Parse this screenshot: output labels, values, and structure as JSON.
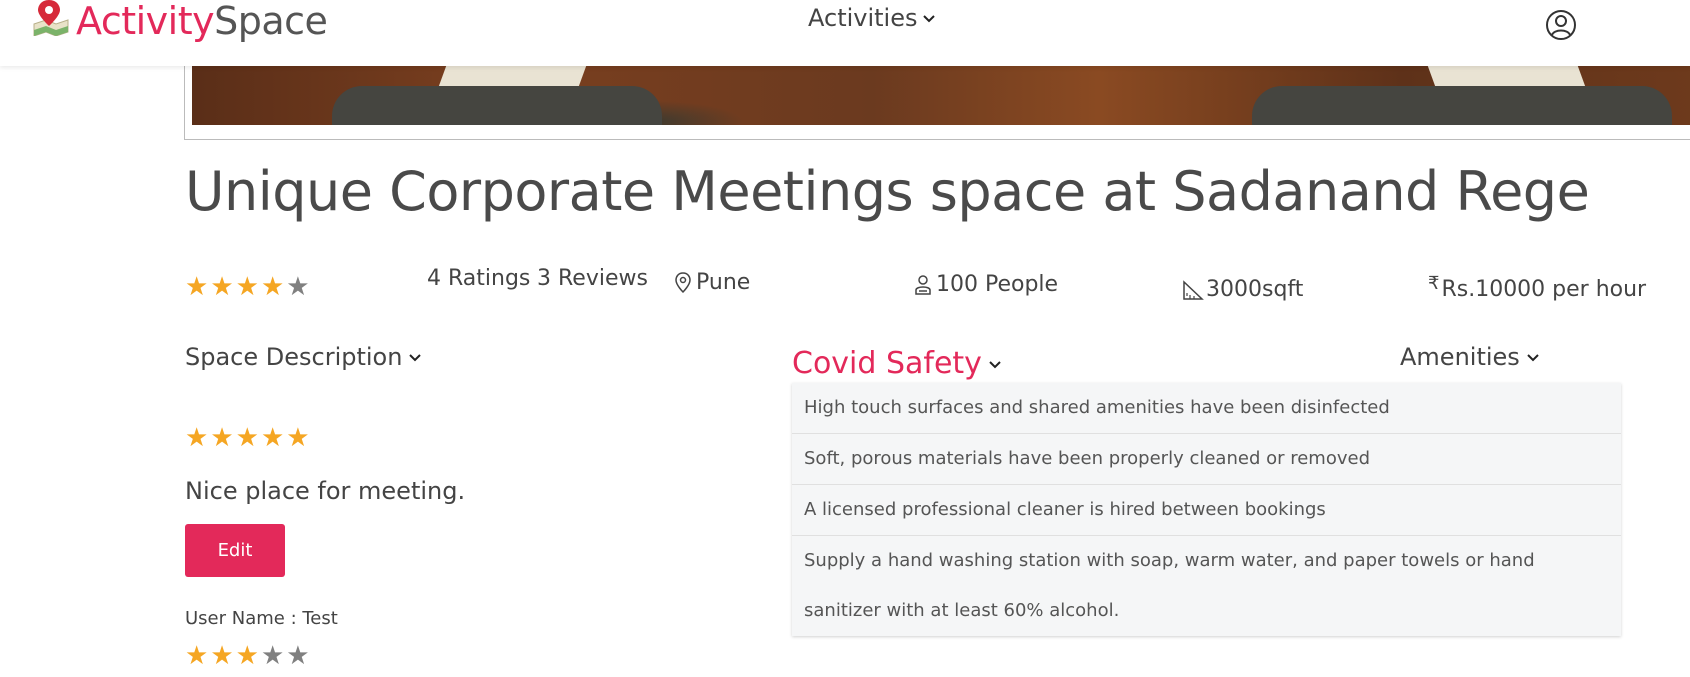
{
  "header": {
    "logo_part1": "Activity",
    "logo_part2": "Space",
    "nav_activities": "Activities"
  },
  "title": "Unique Corporate Meetings space at Sadanand Rege",
  "stats": {
    "rating": 4,
    "ratings_label": "4 Ratings",
    "reviews_label": "3 Reviews",
    "location": "Pune",
    "capacity": "100  People",
    "area": "3000sqft",
    "price": "Rs.10000 per hour"
  },
  "sections": {
    "description": "Space Description",
    "covid": "Covid Safety",
    "amenities": "Amenities"
  },
  "review": {
    "rating": 5,
    "text": "Nice place for meeting.",
    "edit_label": "Edit",
    "user_line": "User Name : Test",
    "user_rating": 3
  },
  "covid_items": [
    "High touch surfaces and shared amenities have been disinfected",
    "Soft, porous materials have been properly cleaned or removed",
    "A licensed professional cleaner is hired between bookings",
    "Supply a hand washing station with soap, warm water, and paper towels or hand sanitizer with at least 60% alcohol."
  ],
  "colors": {
    "brand": "#e3295a",
    "star": "#f5a623",
    "star_off": "#808080"
  }
}
